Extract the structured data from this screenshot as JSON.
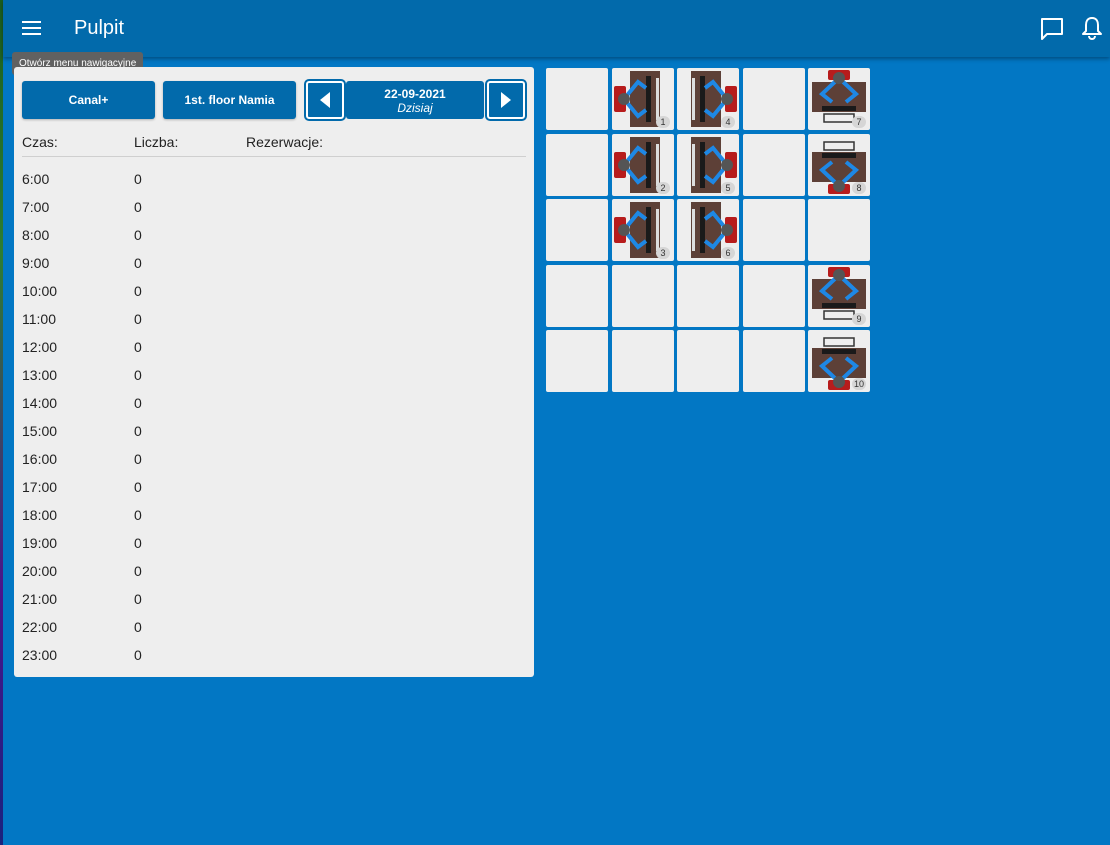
{
  "appbar": {
    "title": "Pulpit",
    "tooltip": "Otwórz menu nawigacyjne",
    "icons": [
      "menu-icon",
      "chat-icon",
      "bell-icon"
    ]
  },
  "toolbar": {
    "company_label": "Canal+",
    "floor_label": "1st. floor Namia",
    "date": "22-09-2021",
    "date_sub": "Dzisiaj"
  },
  "table": {
    "headers": {
      "time": "Czas:",
      "count": "Liczba:",
      "reservations": "Rezerwacje:"
    },
    "rows": [
      {
        "time": "6:00",
        "count": "0"
      },
      {
        "time": "7:00",
        "count": "0"
      },
      {
        "time": "8:00",
        "count": "0"
      },
      {
        "time": "9:00",
        "count": "0"
      },
      {
        "time": "10:00",
        "count": "0"
      },
      {
        "time": "11:00",
        "count": "0"
      },
      {
        "time": "12:00",
        "count": "0"
      },
      {
        "time": "13:00",
        "count": "0"
      },
      {
        "time": "14:00",
        "count": "0"
      },
      {
        "time": "15:00",
        "count": "0"
      },
      {
        "time": "16:00",
        "count": "0"
      },
      {
        "time": "17:00",
        "count": "0"
      },
      {
        "time": "18:00",
        "count": "0"
      },
      {
        "time": "19:00",
        "count": "0"
      },
      {
        "time": "20:00",
        "count": "0"
      },
      {
        "time": "21:00",
        "count": "0"
      },
      {
        "time": "22:00",
        "count": "0"
      },
      {
        "time": "23:00",
        "count": "0"
      }
    ]
  },
  "floorplan": {
    "columns": 5,
    "rows": 5,
    "cells": [
      {
        "desk": null
      },
      {
        "desk": "1",
        "orient": "left"
      },
      {
        "desk": "4",
        "orient": "right"
      },
      {
        "desk": null
      },
      {
        "desk": "7",
        "orient": "down"
      },
      {
        "desk": null
      },
      {
        "desk": "2",
        "orient": "left"
      },
      {
        "desk": "5",
        "orient": "right"
      },
      {
        "desk": null
      },
      {
        "desk": "8",
        "orient": "up"
      },
      {
        "desk": null
      },
      {
        "desk": "3",
        "orient": "left"
      },
      {
        "desk": "6",
        "orient": "right"
      },
      {
        "desk": null
      },
      {
        "desk": null
      },
      {
        "desk": null
      },
      {
        "desk": null
      },
      {
        "desk": null
      },
      {
        "desk": null
      },
      {
        "desk": "9",
        "orient": "down"
      },
      {
        "desk": null
      },
      {
        "desk": null
      },
      {
        "desk": null
      },
      {
        "desk": null
      },
      {
        "desk": "10",
        "orient": "up"
      }
    ]
  },
  "colors": {
    "background": "#0277c4",
    "appbar": "#026aab",
    "panel": "#eeeeee",
    "desk_wood": "#5d4037",
    "chair": "#b71c1c",
    "person": "#1e88e5"
  }
}
